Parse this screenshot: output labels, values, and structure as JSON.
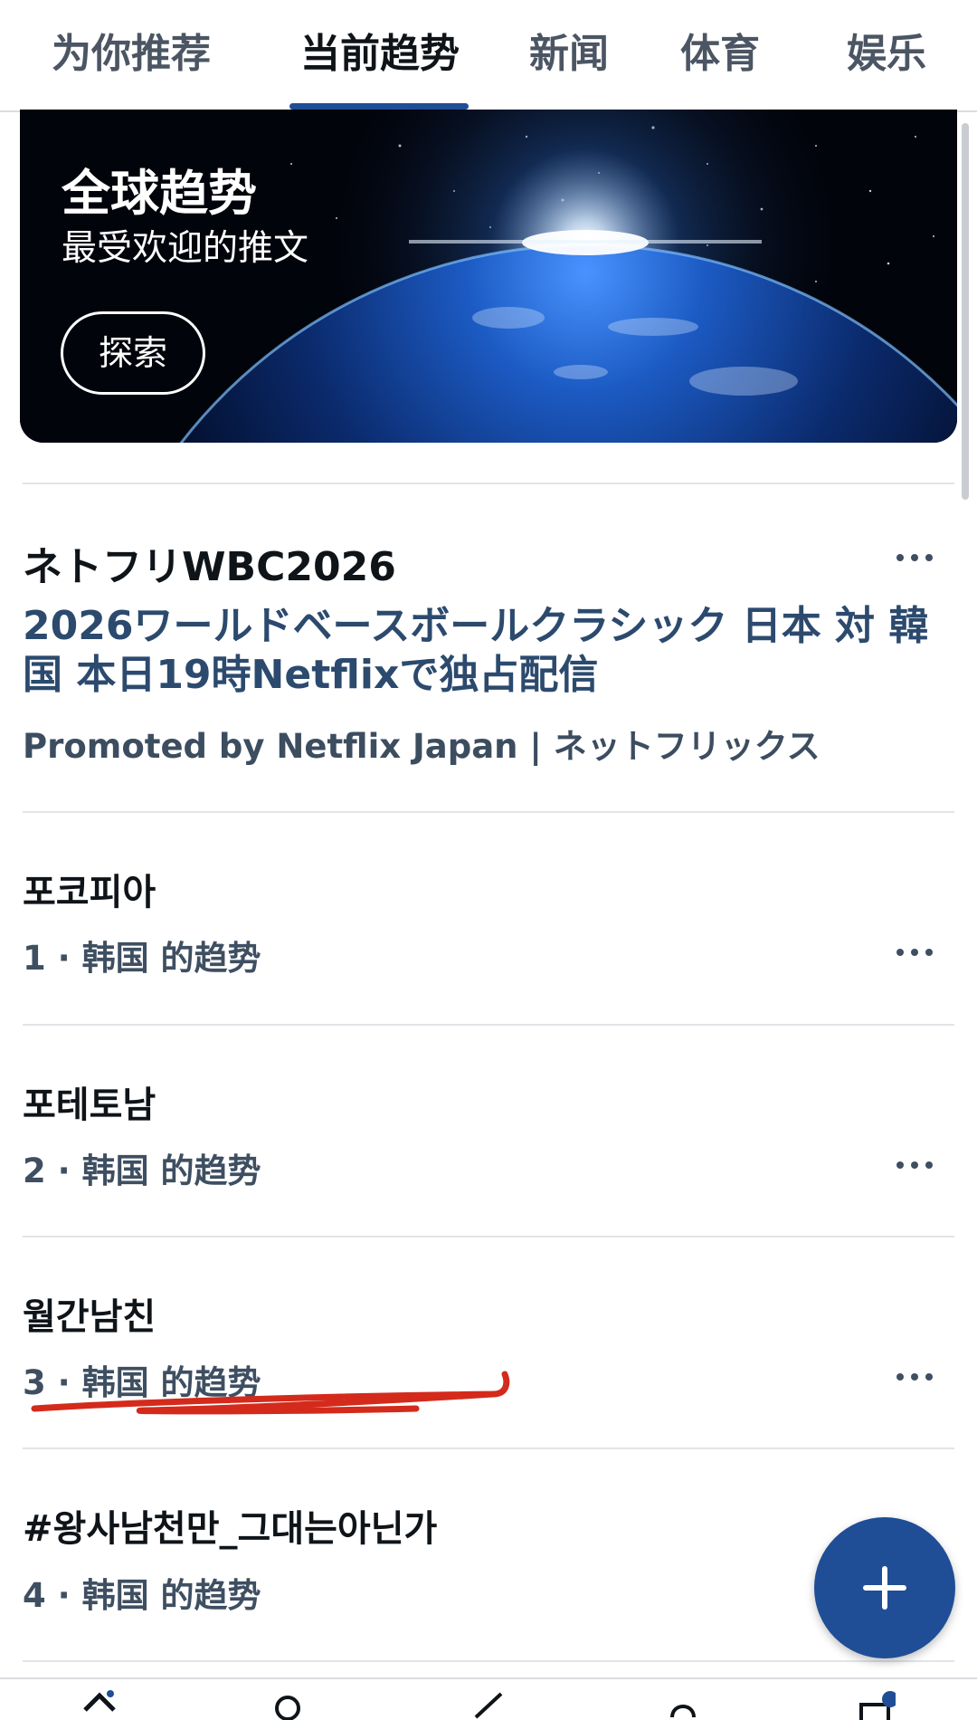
{
  "tabs": [
    {
      "label": "为你推荐"
    },
    {
      "label": "当前趋势",
      "active": true
    },
    {
      "label": "新闻"
    },
    {
      "label": "体育"
    },
    {
      "label": "娱乐"
    }
  ],
  "accent_color": "#1f4e96",
  "banner": {
    "title": "全球趋势",
    "subtitle": "最受欢迎的推文",
    "button_label": "探索"
  },
  "promoted": {
    "title": "ネトフリWBC2026",
    "description": "2026ワールドベースボールクラシック 日本 対 韓国 本日19時Netflixで独占配信",
    "promoted_by": "Promoted by Netflix Japan | ネットフリックス"
  },
  "trends": [
    {
      "title": "포코피아",
      "meta": "1 · 韩国 的趋势"
    },
    {
      "title": "포테토남",
      "meta": "2 · 韩国 的趋势"
    },
    {
      "title": "월간남친",
      "meta": "3 · 韩国 的趋势"
    },
    {
      "title": "#왕사남천만_그대는아닌가",
      "meta": "4 · 韩国 的趋势"
    }
  ],
  "icons": {
    "more": "more-horizontal-icon",
    "compose": "plus-icon",
    "home": "home-icon",
    "search": "search-icon",
    "grok": "grok-icon",
    "notifications": "bell-icon",
    "messages": "mail-icon"
  },
  "annotation_color": "#d42a1c"
}
